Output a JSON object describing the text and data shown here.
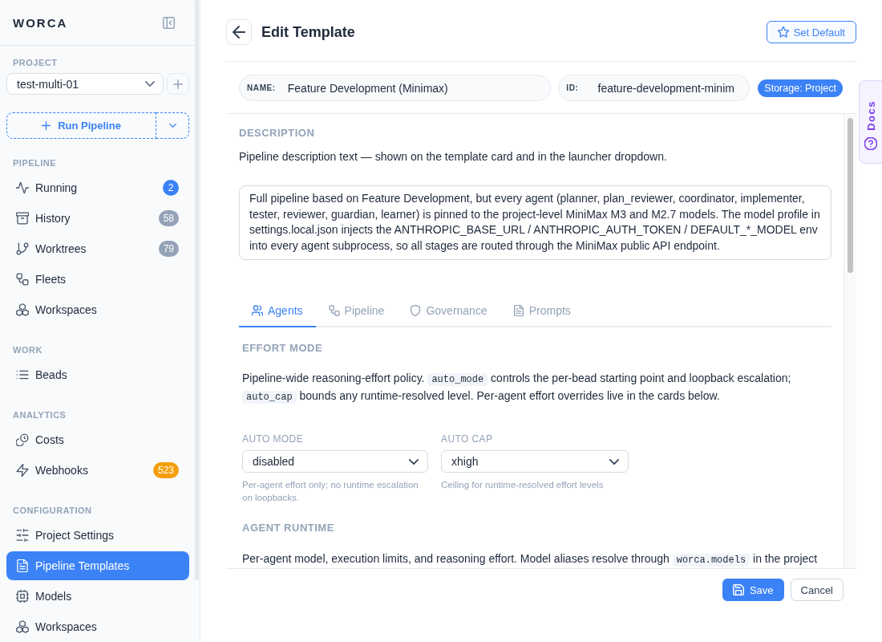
{
  "sidebar": {
    "logo": "WORCA",
    "project": {
      "label": "PROJECT",
      "value": "test-multi-01"
    },
    "run_button": {
      "label": "Run Pipeline"
    },
    "sections": [
      {
        "title": "PIPELINE",
        "items": [
          {
            "label": "Running",
            "selected": false,
            "badge": {
              "text": "2",
              "color": "#3b82f6"
            }
          },
          {
            "label": "History",
            "selected": false,
            "badge": {
              "text": "58",
              "color": "#94a3b8"
            }
          },
          {
            "label": "Worktrees",
            "selected": false,
            "badge": {
              "text": "79",
              "color": "#94a3b8"
            }
          },
          {
            "label": "Fleets",
            "selected": false
          },
          {
            "label": "Workspaces",
            "selected": false
          }
        ]
      },
      {
        "title": "WORK",
        "items": [
          {
            "label": "Beads",
            "selected": false
          }
        ]
      },
      {
        "title": "ANALYTICS",
        "items": [
          {
            "label": "Costs",
            "selected": false
          },
          {
            "label": "Webhooks",
            "selected": false,
            "badge": {
              "text": "523",
              "color": "#f59e0b"
            }
          }
        ]
      },
      {
        "title": "CONFIGURATION",
        "items": [
          {
            "label": "Project Settings",
            "selected": false
          },
          {
            "label": "Pipeline Templates",
            "selected": true
          },
          {
            "label": "Models",
            "selected": false
          },
          {
            "label": "Workspaces",
            "selected": false
          }
        ]
      }
    ]
  },
  "header": {
    "title": "Edit Template",
    "set_default": {
      "label": "Set Default"
    }
  },
  "meta": {
    "name": {
      "label": "NAME:",
      "value": "Feature Development (Minimax)"
    },
    "id": {
      "label": "ID:",
      "value": "feature-development-minim"
    },
    "storage": "Storage: Project"
  },
  "description": {
    "title": "DESCRIPTION",
    "help": "Pipeline description text — shown on the template card and in the launcher dropdown.",
    "value": "Full pipeline based on Feature Development, but every agent (planner, plan_reviewer, coordinator, implementer, tester, reviewer, guardian, learner) is pinned to the project-level MiniMax M3 and M2.7 models. The model profile in settings.local.json injects the ANTHROPIC_BASE_URL / ANTHROPIC_AUTH_TOKEN / DEFAULT_*_MODEL env into every agent subprocess, so all stages are routed through the MiniMax public API endpoint."
  },
  "tabs": [
    {
      "label": "Agents",
      "selected": true
    },
    {
      "label": "Pipeline",
      "selected": false
    },
    {
      "label": "Governance",
      "selected": false
    },
    {
      "label": "Prompts",
      "selected": false
    }
  ],
  "effort_mode": {
    "title": "EFFORT MODE",
    "text": [
      {
        "kind": "text",
        "text": "Pipeline-wide reasoning-effort policy. "
      },
      {
        "kind": "code",
        "text": "auto_mode"
      },
      {
        "kind": "text",
        "text": " controls the per-bead starting point and loopback escalation; "
      },
      {
        "kind": "code",
        "text": "auto_cap"
      },
      {
        "kind": "text",
        "text": " bounds any runtime-resolved level. Per-agent effort overrides live in the cards below."
      }
    ],
    "fields": [
      {
        "label": "AUTO MODE",
        "value": "disabled",
        "hint": "Per-agent effort only; no runtime escalation on loopbacks."
      },
      {
        "label": "AUTO CAP",
        "value": "xhigh",
        "hint": "Ceiling for runtime-resolved effort levels"
      }
    ]
  },
  "agent_runtime": {
    "title": "AGENT RUNTIME",
    "text": [
      {
        "kind": "text",
        "text": "Per-agent model, execution limits, and reasoning effort. Model aliases resolve through "
      },
      {
        "kind": "code",
        "text": "worca.models"
      },
      {
        "kind": "text",
        "text": " in the project"
      }
    ]
  },
  "footer": {
    "buttons": [
      {
        "label": "Save",
        "kind": "primary"
      },
      {
        "label": "Cancel",
        "kind": "secondary"
      }
    ]
  },
  "docs_tab": {
    "label": "Docs"
  }
}
